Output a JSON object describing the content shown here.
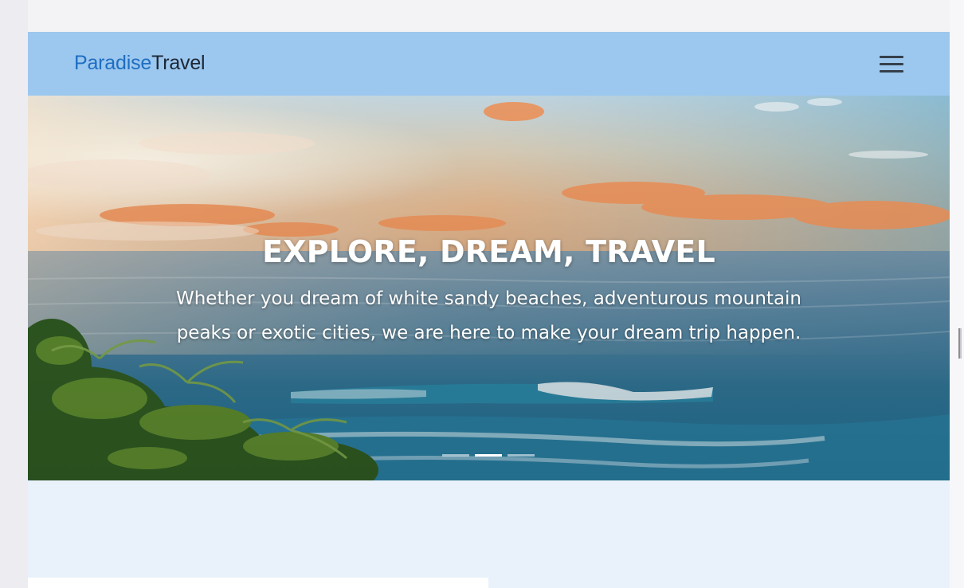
{
  "navbar": {
    "brand_part1": "Paradise",
    "brand_part2": "Travel",
    "menu_icon": "hamburger-menu-icon"
  },
  "hero": {
    "title": "EXPLORE, DREAM, TRAVEL",
    "subtitle": "Whether you dream of white sandy beaches, adventurous mountain peaks or exotic cities, we are here to make your dream trip happen.",
    "slides_count": 3,
    "active_slide": 2
  },
  "colors": {
    "navbar_bg": "#9cc7ee",
    "brand_accent": "#1e6ec2",
    "brand_dark": "#1d2735",
    "page_bg": "#e9f2fb"
  }
}
